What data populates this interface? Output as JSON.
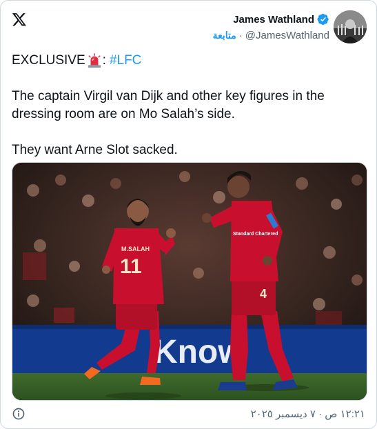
{
  "author": {
    "name": "James Wathland",
    "handle": "@JamesWathland",
    "follow_label": "متابعة",
    "separator": "·"
  },
  "tweet": {
    "line1_prefix": "EXCLUSIVE",
    "line1_colon": ":",
    "hashtag": "#LFC",
    "paragraph2": "The captain Virgil van Dijk and other key figures in the dressing room are on Mo Salah’s side.",
    "paragraph3": "They want Arne Slot sacked."
  },
  "photo": {
    "player_left_number": "11",
    "player_left_name": "M.SALAH",
    "player_right_number": "4",
    "sponsor": "Standard Chartered",
    "board_text": "Know"
  },
  "footer": {
    "timestamp": "١٢:٢١ ص · ٧ ديسمبر ٢٠٢٥"
  },
  "icons": {
    "logo": "x-logo-icon",
    "verified": "verified-badge-icon",
    "emoji": "police-light-emoji",
    "info": "info-icon"
  },
  "colors": {
    "accent": "#1d9bf0",
    "text": "#0f1419",
    "muted": "#536471",
    "kit_red": "#c8102e"
  }
}
